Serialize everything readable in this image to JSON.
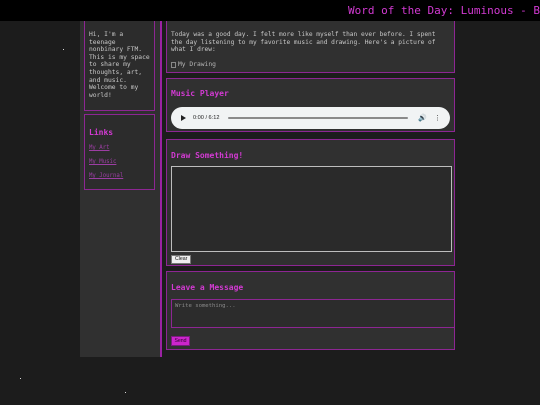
{
  "marquee": {
    "text": "Word of the Day: Luminous - Brin"
  },
  "about": {
    "text": "Hi, I'm a teenage nonbinary FTM. This is my space to share my thoughts, art, and music. Welcome to my world!"
  },
  "links": {
    "title": "Links",
    "items": [
      {
        "label": "My Art"
      },
      {
        "label": "My Music"
      },
      {
        "label": "My Journal"
      }
    ]
  },
  "blog": {
    "text": "Today was a good day. I felt more like myself than ever before. I spent the day listening to my favorite music and drawing. Here's a picture of what I drew:",
    "image_alt": "My Drawing"
  },
  "music": {
    "title": "Music Player",
    "time": "0:00 / 6:12"
  },
  "draw": {
    "title": "Draw Something!",
    "clear_label": "Clear"
  },
  "message": {
    "title": "Leave a Message",
    "placeholder": "Write something...",
    "send_label": "Send"
  },
  "colors": {
    "accent": "#d23ad2",
    "border": "#8d2693",
    "background": "#1c1c1c"
  },
  "icons": [
    "play-icon",
    "volume-icon",
    "more-options-icon",
    "broken-image-icon"
  ]
}
